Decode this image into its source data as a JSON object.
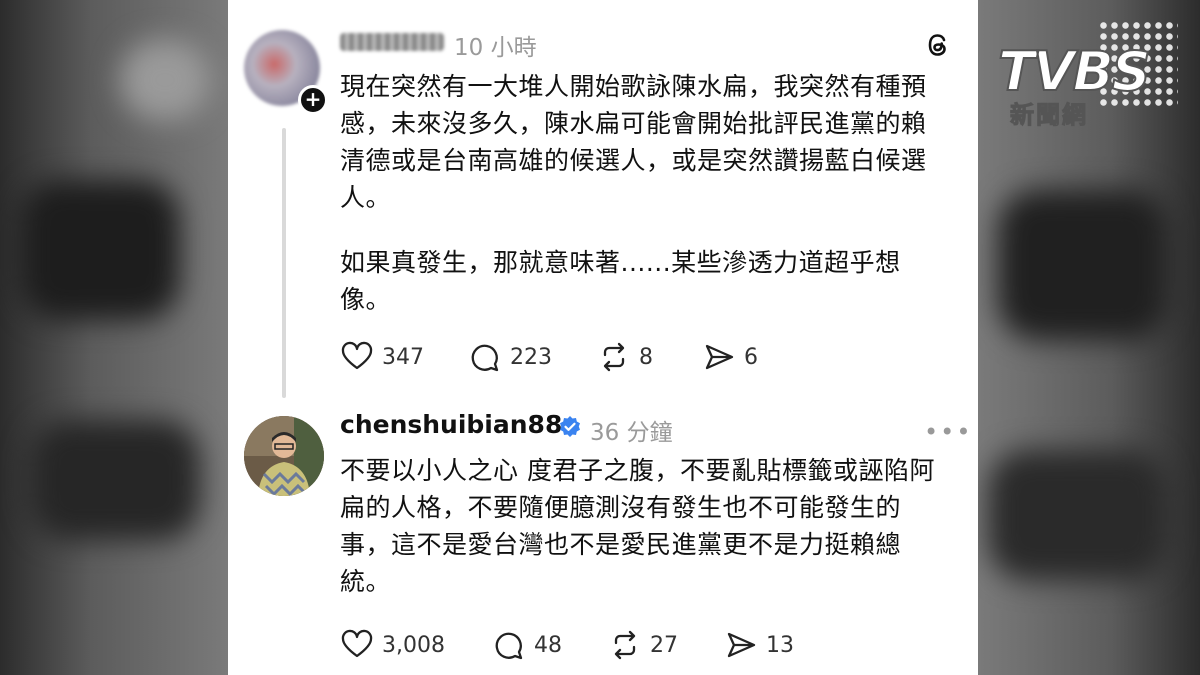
{
  "brand": {
    "logo_text": "TVBS",
    "logo_subtitle": "新聞網"
  },
  "post1": {
    "username": "",
    "time": "10 小時",
    "paragraph1": "現在突然有一大堆人開始歌詠陳水扁，我突然有種預感，未來沒多久，陳水扁可能會開始批評民進黨的賴清德或是台南高雄的候選人，或是突然讚揚藍白候選人。",
    "paragraph2": "如果真發生，那就意味著......某些滲透力道超乎想像。",
    "likes": "347",
    "comments": "223",
    "reposts": "8",
    "shares": "6"
  },
  "post2": {
    "username": "chenshuibian88",
    "time": "36 分鐘",
    "text": "不要以小人之心 度君子之腹，不要亂貼標籤或誣陷阿扁的人格，不要隨便臆測沒有發生也不可能發生的事，這不是愛台灣也不是愛民進黨更不是力挺賴總統。",
    "likes": "3,008",
    "comments": "48",
    "reposts": "27",
    "shares": "13",
    "more": "•••"
  },
  "colors": {
    "verified": "#3a83f0",
    "muted": "#9a9a9a",
    "text": "#111111"
  },
  "icons": [
    "threads-logo-icon",
    "heart-icon",
    "comment-icon",
    "repost-icon",
    "share-icon",
    "verified-badge-icon",
    "more-icon",
    "plus-icon"
  ]
}
